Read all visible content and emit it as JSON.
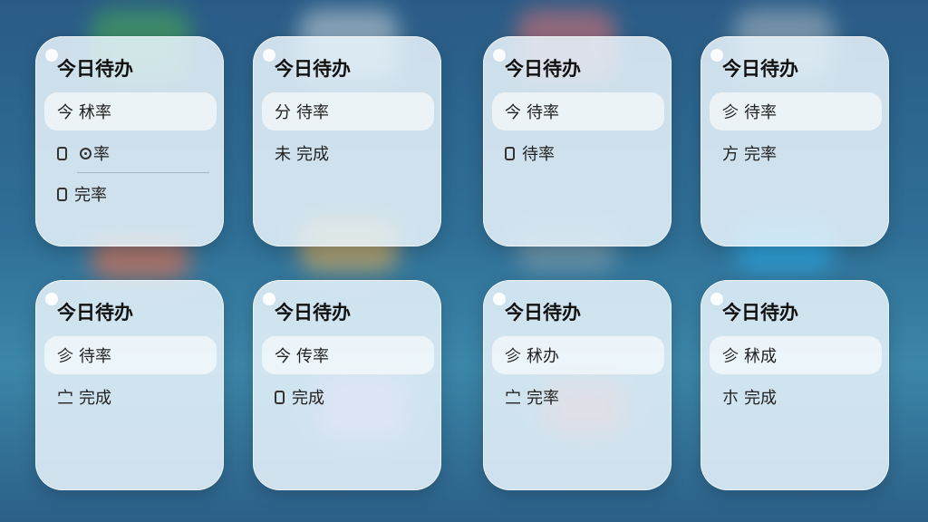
{
  "widgets": [
    {
      "title": "今日待办",
      "items": [
        {
          "type": "text",
          "prefix": "今",
          "label": "秫率",
          "highlight": true
        },
        {
          "type": "ring",
          "label": "率",
          "highlight": false
        },
        {
          "type": "checkbox",
          "label": "完率",
          "highlight": false
        }
      ]
    },
    {
      "title": "今日待办",
      "items": [
        {
          "type": "text",
          "prefix": "分",
          "label": "待率",
          "highlight": true
        },
        {
          "type": "text",
          "prefix": "未",
          "label": "完成",
          "highlight": false
        }
      ]
    },
    {
      "title": "今日待办",
      "items": [
        {
          "type": "text",
          "prefix": "今",
          "label": "待率",
          "highlight": true
        },
        {
          "type": "checkbox",
          "label": "待率",
          "highlight": false
        }
      ]
    },
    {
      "title": "今日待办",
      "items": [
        {
          "type": "text",
          "prefix": "㐱",
          "label": "待率",
          "highlight": true
        },
        {
          "type": "text",
          "prefix": "方",
          "label": "完率",
          "highlight": false
        }
      ]
    },
    {
      "title": "今日待办",
      "items": [
        {
          "type": "text",
          "prefix": "㐱",
          "label": "待率",
          "highlight": true
        },
        {
          "type": "text",
          "prefix": "㝉",
          "label": "完成",
          "highlight": false
        }
      ]
    },
    {
      "title": "今日待办",
      "items": [
        {
          "type": "text",
          "prefix": "今",
          "label": "传率",
          "highlight": true
        },
        {
          "type": "checkbox",
          "label": "完成",
          "highlight": false
        }
      ]
    },
    {
      "title": "今日待办",
      "items": [
        {
          "type": "text",
          "prefix": "㐱",
          "label": "秫办",
          "highlight": true
        },
        {
          "type": "text",
          "prefix": "㝉",
          "label": "完率",
          "highlight": false
        }
      ]
    },
    {
      "title": "今日待办",
      "items": [
        {
          "type": "text",
          "prefix": "㐱",
          "label": "秫成",
          "highlight": true
        },
        {
          "type": "text",
          "prefix": "朩",
          "label": "完成",
          "highlight": false
        }
      ]
    }
  ]
}
